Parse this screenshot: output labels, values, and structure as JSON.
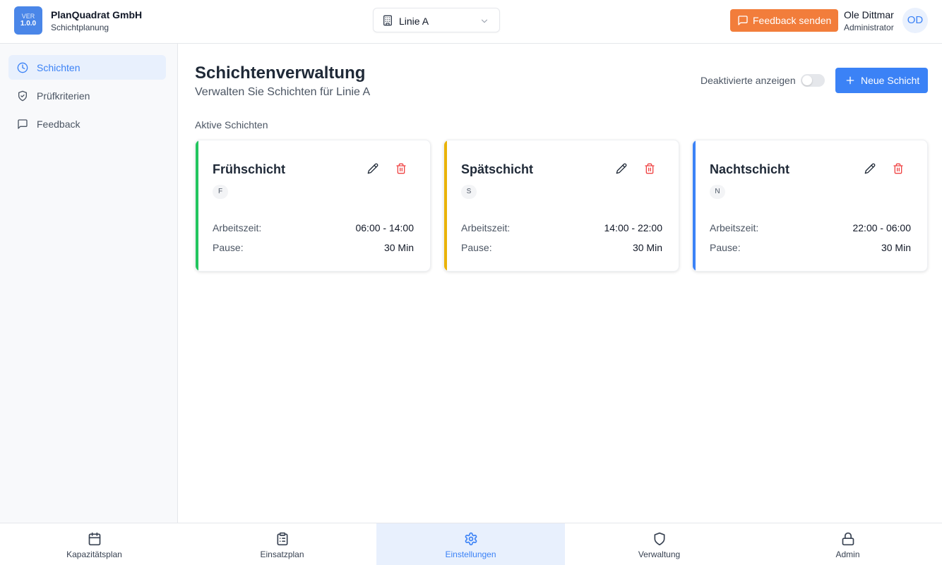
{
  "header": {
    "logo_line1": "VER",
    "logo_line2": "1.0.0",
    "company": "PlanQuadrat GmbH",
    "subtitle": "Schichtplanung",
    "line_select": "Linie A",
    "feedback_button": "Feedback senden",
    "user_name": "Ole Dittmar",
    "user_role": "Administrator",
    "avatar_initials": "OD"
  },
  "sidebar": {
    "items": [
      {
        "label": "Schichten",
        "icon": "clock-icon",
        "active": true
      },
      {
        "label": "Prüfkriterien",
        "icon": "shield-check-icon",
        "active": false
      },
      {
        "label": "Feedback",
        "icon": "message-square-icon",
        "active": false
      }
    ]
  },
  "main": {
    "title": "Schichtenverwaltung",
    "subtitle": "Verwalten Sie Schichten für Linie A",
    "toggle_label": "Deaktivierte anzeigen",
    "toggle_on": false,
    "new_button": "Neue Schicht",
    "section_label": "Aktive Schichten",
    "cards": [
      {
        "title": "Frühschicht",
        "code": "F",
        "color": "#22c55e",
        "worktime_label": "Arbeitszeit:",
        "worktime": "06:00 - 14:00",
        "pause_label": "Pause:",
        "pause": "30 Min"
      },
      {
        "title": "Spätschicht",
        "code": "S",
        "color": "#eab308",
        "worktime_label": "Arbeitszeit:",
        "worktime": "14:00 - 22:00",
        "pause_label": "Pause:",
        "pause": "30 Min"
      },
      {
        "title": "Nachtschicht",
        "code": "N",
        "color": "#3b82f6",
        "worktime_label": "Arbeitszeit:",
        "worktime": "22:00 - 06:00",
        "pause_label": "Pause:",
        "pause": "30 Min"
      }
    ]
  },
  "bottom_nav": {
    "items": [
      {
        "label": "Kapazitätsplan",
        "icon": "calendar-icon",
        "active": false
      },
      {
        "label": "Einsatzplan",
        "icon": "clipboard-list-icon",
        "active": false
      },
      {
        "label": "Einstellungen",
        "icon": "gear-icon",
        "active": true
      },
      {
        "label": "Verwaltung",
        "icon": "shield-icon",
        "active": false
      },
      {
        "label": "Admin",
        "icon": "lock-icon",
        "active": false
      }
    ]
  },
  "colors": {
    "primary": "#3b82f6",
    "feedback": "#f27d3b",
    "danger": "#ef4444"
  }
}
